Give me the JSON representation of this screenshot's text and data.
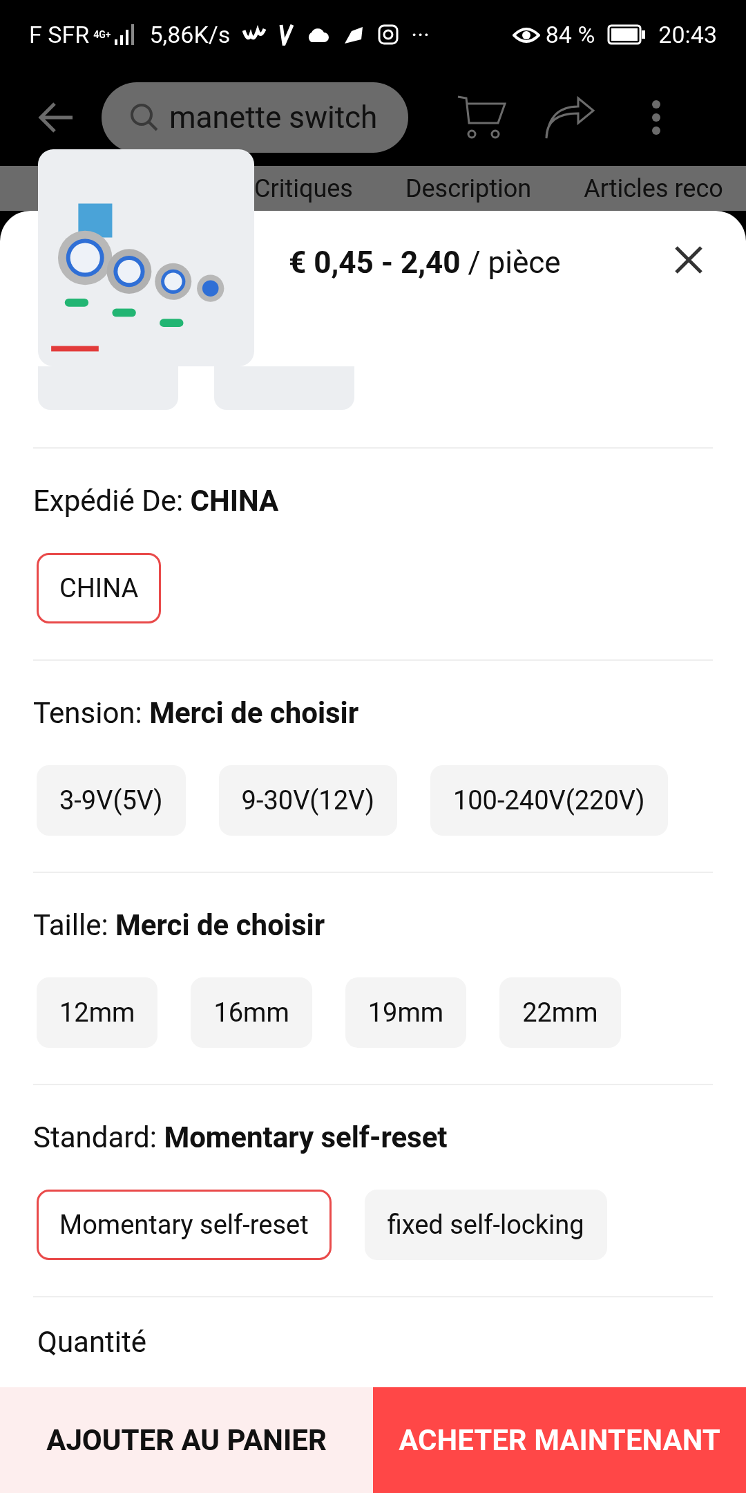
{
  "status_bar": {
    "carrier": "F SFR",
    "network": "4G+",
    "speed": "5,86K/s",
    "more": "···",
    "battery": "84 %",
    "time": "20:43"
  },
  "header": {
    "search": {
      "value": "manette switch"
    }
  },
  "tabs": [
    {
      "label": "Critiques",
      "selected": false
    },
    {
      "label": "Description",
      "selected": false
    },
    {
      "label": "Articles reco",
      "selected": false
    }
  ],
  "sheet": {
    "price": "€ 0,45 - 2,40",
    "unit": "/ pièce",
    "sections": [
      {
        "label": "Expédié De:",
        "value": "CHINA",
        "options": [
          {
            "label": "CHINA",
            "selected": true
          }
        ]
      },
      {
        "label": "Tension:",
        "value": "Merci de choisir",
        "options": [
          {
            "label": "3-9V(5V)",
            "selected": false
          },
          {
            "label": "9-30V(12V)",
            "selected": false
          },
          {
            "label": "100-240V(220V)",
            "selected": false
          }
        ]
      },
      {
        "label": "Taille:",
        "value": "Merci de choisir",
        "options": [
          {
            "label": "12mm",
            "selected": false
          },
          {
            "label": "16mm",
            "selected": false
          },
          {
            "label": "19mm",
            "selected": false
          },
          {
            "label": "22mm",
            "selected": false
          }
        ]
      },
      {
        "label": "Standard:",
        "value": "Momentary self-reset",
        "options": [
          {
            "label": "Momentary self-reset",
            "selected": true
          },
          {
            "label": "fixed self-locking",
            "selected": false
          }
        ]
      }
    ],
    "quantity_label": "Quantité"
  },
  "actions": {
    "add_to_cart": "AJOUTER AU PANIER",
    "buy_now": "ACHETER MAINTENANT"
  }
}
